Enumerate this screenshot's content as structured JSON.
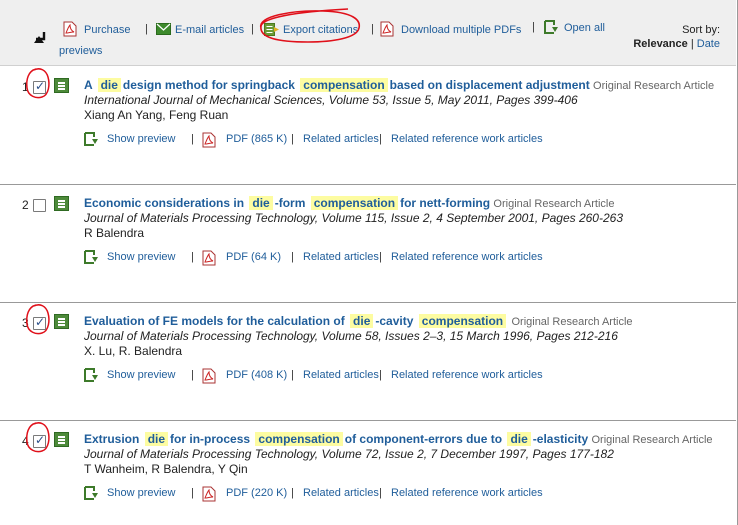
{
  "toolbar": {
    "purchase": "Purchase",
    "email": "E-mail articles",
    "export": "Export citations",
    "download": "Download multiple PDFs",
    "open_all_1": "Open all",
    "open_all_2": "previews",
    "sort_by": "Sort by:",
    "sort_relevance": "Relevance",
    "sort_sep": "|",
    "sort_date": "Date"
  },
  "results": [
    {
      "number": "1",
      "checked": true,
      "title_parts": [
        "A",
        "die",
        "design method for springback",
        "compensation",
        "based on displacement adjustment"
      ],
      "article_type": "Original Research Article",
      "journal": "International Journal of Mechanical Sciences, Volume 53, Issue 5, May 2011, Pages 399-406",
      "authors": "Xiang An Yang, Feng Ruan",
      "show_preview": "Show preview",
      "pdf": "PDF (865 K)",
      "related": "Related articles",
      "related_ref": "Related reference work articles"
    },
    {
      "number": "2",
      "checked": false,
      "title_parts": [
        "Economic considerations in",
        "die",
        "-form",
        "compensation",
        "for nett-forming"
      ],
      "article_type": "Original Research Article",
      "journal": "Journal of Materials Processing Technology, Volume 115, Issue 2, 4 September 2001, Pages 260-263",
      "authors": "R Balendra",
      "show_preview": "Show preview",
      "pdf": "PDF (64 K)",
      "related": "Related articles",
      "related_ref": "Related reference work articles"
    },
    {
      "number": "3",
      "checked": true,
      "title_parts": [
        "Evaluation of FE models for the calculation of",
        "die",
        "-cavity",
        "compensation",
        ""
      ],
      "article_type": "Original Research Article",
      "journal": "Journal of Materials Processing Technology, Volume 58, Issues 2–3, 15 March 1996, Pages 212-216",
      "authors": "X. Lu, R. Balendra",
      "show_preview": "Show preview",
      "pdf": "PDF (408 K)",
      "related": "Related articles",
      "related_ref": "Related reference work articles"
    },
    {
      "number": "4",
      "checked": true,
      "title_parts": [
        "Extrusion",
        "die",
        "for in-process",
        "compensation",
        "of component-errors due to",
        "die",
        "-elasticity"
      ],
      "article_type": "Original Research Article",
      "journal": "Journal of Materials Processing Technology, Volume 72, Issue 2, 7 December 1997, Pages 177-182",
      "authors": "T Wanheim, R Balendra, Y Qin",
      "show_preview": "Show preview",
      "pdf": "PDF (220 K)",
      "related": "Related articles",
      "related_ref": "Related reference work articles"
    }
  ],
  "colors": {
    "link": "#1f5d9a",
    "highlight": "#fdfca1",
    "annotation_red": "#e0101a",
    "doc_icon_green": "#4d8a3a"
  }
}
